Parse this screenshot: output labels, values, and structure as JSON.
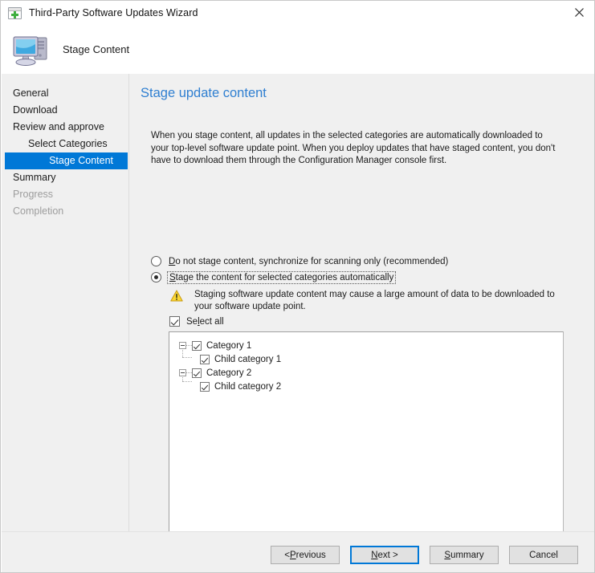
{
  "window": {
    "title": "Third-Party Software Updates Wizard",
    "title_icon": "window-plus-icon",
    "close_icon": "close-icon"
  },
  "header": {
    "icon": "computer-icon",
    "title": "Stage Content"
  },
  "sidebar": {
    "items": [
      {
        "label": "General",
        "state": "normal",
        "level": 0
      },
      {
        "label": "Download",
        "state": "normal",
        "level": 0
      },
      {
        "label": "Review and approve",
        "state": "normal",
        "level": 0
      },
      {
        "label": "Select Categories",
        "state": "normal",
        "level": 1
      },
      {
        "label": "Stage Content",
        "state": "active",
        "level": 1
      },
      {
        "label": "Summary",
        "state": "normal",
        "level": 0
      },
      {
        "label": "Progress",
        "state": "disabled",
        "level": 0
      },
      {
        "label": "Completion",
        "state": "disabled",
        "level": 0
      }
    ]
  },
  "content": {
    "heading": "Stage update content",
    "intro": "When you stage content, all updates in the selected categories are automatically downloaded to your top-level software update point. When you deploy updates that have staged content, you don't have to download them through the Configuration Manager console first.",
    "radio_options": [
      {
        "id": "do-not-stage",
        "accelerator": "D",
        "label_rest": "o not stage content, synchronize for scanning only (recommended)",
        "selected": false,
        "focused": false
      },
      {
        "id": "stage-automatically",
        "accelerator": "S",
        "label_rest": "tage the content for selected categories automatically",
        "selected": true,
        "focused": true
      }
    ],
    "warning": {
      "icon": "warning-triangle-icon",
      "text": "Staging software update content may cause a large amount of data to be downloaded to your software update point."
    },
    "select_all": {
      "label_pre": "Se",
      "accelerator": "l",
      "label_rest": "ect all",
      "checked": true
    },
    "tree": [
      {
        "label": "Category 1",
        "checked": true,
        "expanded": true,
        "children": [
          {
            "label": "Child category 1",
            "checked": true
          }
        ]
      },
      {
        "label": "Category 2",
        "checked": true,
        "expanded": true,
        "children": [
          {
            "label": "Child category 2",
            "checked": true
          }
        ]
      }
    ]
  },
  "footer": {
    "buttons": [
      {
        "id": "previous",
        "pre": "< ",
        "accelerator": "P",
        "rest": "revious",
        "default": false
      },
      {
        "id": "next",
        "pre": "",
        "accelerator": "N",
        "rest": "ext >",
        "default": true
      },
      {
        "id": "summary",
        "pre": "",
        "accelerator": "S",
        "rest": "ummary",
        "default": false
      },
      {
        "id": "cancel",
        "pre": "Cancel",
        "accelerator": "",
        "rest": "",
        "default": false
      }
    ]
  },
  "colors": {
    "accent": "#0078d7",
    "heading": "#2f7fd1",
    "panel": "#f0f0f0",
    "warning": "#f5c518"
  }
}
